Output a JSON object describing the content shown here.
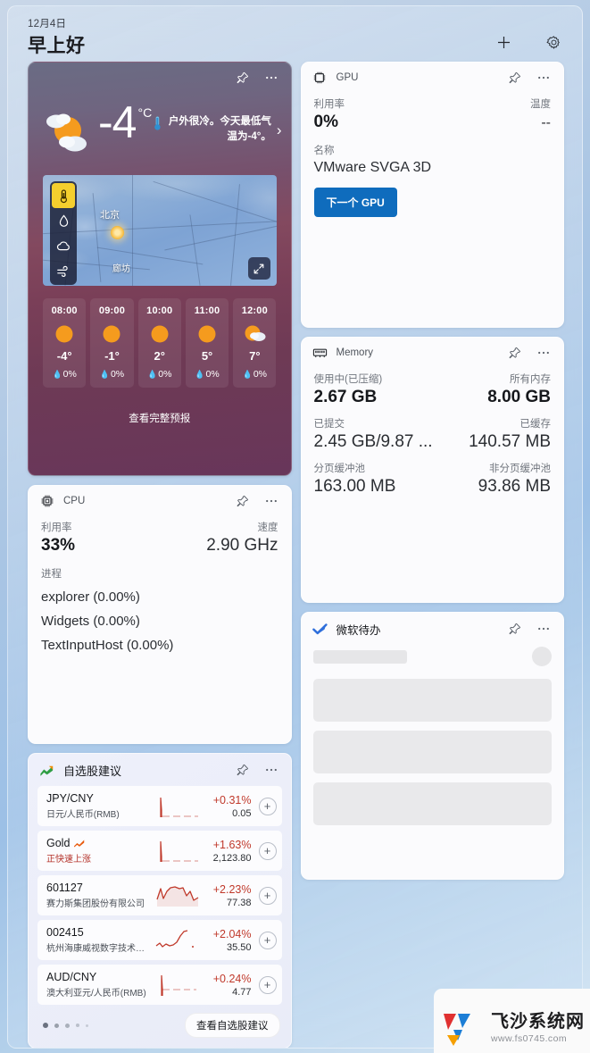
{
  "header": {
    "date": "12月4日",
    "greeting": "早上好",
    "add_icon": "plus-icon",
    "settings_icon": "gear-icon"
  },
  "weather": {
    "pin_icon": "pin-icon",
    "more_icon": "more-options-icon",
    "temperature": "-4",
    "unit": "°C",
    "condition_icon": "sun-behind-cloud-icon",
    "advisory": "户外很冷。今天最低气温为-4°。",
    "advisory_icon": "thermometer-icon",
    "chevron": "›",
    "map": {
      "city_primary": "北京",
      "city_secondary": "廊坊",
      "layers": [
        {
          "name": "temperature-layer",
          "icon": "thermometer-icon",
          "active": true
        },
        {
          "name": "precipitation-layer",
          "icon": "water-drop-icon",
          "active": false
        },
        {
          "name": "clouds-layer",
          "icon": "cloud-icon",
          "active": false
        },
        {
          "name": "wind-layer",
          "icon": "wind-icon",
          "active": false
        }
      ],
      "expand_icon": "expand-icon"
    },
    "hourly": [
      {
        "time": "08:00",
        "icon": "sun-icon",
        "temp": "-4°",
        "precip": "0%"
      },
      {
        "time": "09:00",
        "icon": "sun-icon",
        "temp": "-1°",
        "precip": "0%"
      },
      {
        "time": "10:00",
        "icon": "sun-icon",
        "temp": "2°",
        "precip": "0%"
      },
      {
        "time": "11:00",
        "icon": "sun-icon",
        "temp": "5°",
        "precip": "0%"
      },
      {
        "time": "12:00",
        "icon": "sun-cloud-icon",
        "temp": "7°",
        "precip": "0%"
      }
    ],
    "cta": "查看完整预报"
  },
  "cpu": {
    "title": "CPU",
    "icon": "cpu-chip-icon",
    "pin_icon": "pin-icon",
    "more_icon": "more-options-icon",
    "usage_label": "利用率",
    "usage_value": "33%",
    "speed_label": "速度",
    "speed_value": "2.90 GHz",
    "processes_label": "进程",
    "processes": [
      "explorer (0.00%)",
      "Widgets (0.00%)",
      "TextInputHost (0.00%)"
    ]
  },
  "gpu": {
    "title": "GPU",
    "icon": "gpu-chip-icon",
    "pin_icon": "pin-icon",
    "more_icon": "more-options-icon",
    "usage_label": "利用率",
    "usage_value": "0%",
    "temp_label": "温度",
    "temp_value": "--",
    "name_label": "名称",
    "name_value": "VMware SVGA 3D",
    "next_button": "下一个 GPU",
    "accent_color": "#0f6cbd"
  },
  "memory": {
    "title": "Memory",
    "icon": "memory-stick-icon",
    "pin_icon": "pin-icon",
    "more_icon": "more-options-icon",
    "in_use_label": "使用中(已压缩)",
    "in_use_value": "2.67 GB",
    "total_label": "所有内存",
    "total_value": "8.00 GB",
    "committed_label": "已提交",
    "committed_value": "2.45 GB/9.87 ...",
    "cached_label": "已缓存",
    "cached_value": "140.57 MB",
    "paged_pool_label": "分页缓冲池",
    "paged_pool_value": "163.00 MB",
    "nonpaged_pool_label": "非分页缓冲池",
    "nonpaged_pool_value": "93.86 MB"
  },
  "todo": {
    "title": "微软待办",
    "icon": "checkmark-icon",
    "pin_icon": "pin-icon",
    "more_icon": "more-options-icon"
  },
  "stocks": {
    "title": "自选股建议",
    "icon": "stock-trend-icon",
    "pin_icon": "pin-icon",
    "more_icon": "more-options-icon",
    "rows": [
      {
        "symbol": "JPY/CNY",
        "name": "日元/人民币(RMB)",
        "change": "+0.31%",
        "price": "0.05",
        "hot": false,
        "trend_icon": null,
        "add_icon": "plus-icon"
      },
      {
        "symbol": "Gold",
        "name": "正快速上涨",
        "change": "+1.63%",
        "price": "2,123.80",
        "hot": true,
        "trend_icon": "rising-icon",
        "add_icon": "plus-icon"
      },
      {
        "symbol": "601127",
        "name": "赛力斯集团股份有限公司",
        "change": "+2.23%",
        "price": "77.38",
        "hot": false,
        "trend_icon": null,
        "add_icon": "plus-icon"
      },
      {
        "symbol": "002415",
        "name": "杭州海康威视数字技术股份...",
        "change": "+2.04%",
        "price": "35.50",
        "hot": false,
        "trend_icon": null,
        "add_icon": "plus-icon"
      },
      {
        "symbol": "AUD/CNY",
        "name": "澳大利亚元/人民币(RMB)",
        "change": "+0.24%",
        "price": "4.77",
        "hot": false,
        "trend_icon": null,
        "add_icon": "plus-icon"
      }
    ],
    "page_dots": 5,
    "cta": "查看自选股建议"
  },
  "watermark": {
    "title": "飞沙系统网",
    "url": "www.fs0745.com"
  }
}
